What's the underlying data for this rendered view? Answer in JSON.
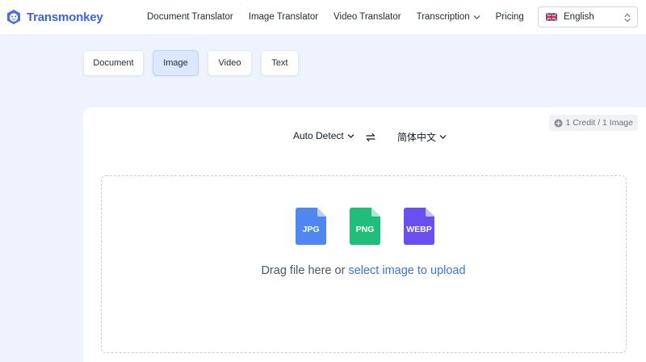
{
  "brand": {
    "name": "Transmonkey",
    "color": "#3f63d9"
  },
  "nav": {
    "items": [
      {
        "label": "Document Translator"
      },
      {
        "label": "Image Translator"
      },
      {
        "label": "Video Translator"
      },
      {
        "label": "Transcription",
        "has_dropdown": true
      },
      {
        "label": "Pricing"
      }
    ]
  },
  "language_select": {
    "value": "English",
    "flag": "uk-flag-icon"
  },
  "tabs": [
    {
      "label": "Document",
      "active": false
    },
    {
      "label": "Image",
      "active": true
    },
    {
      "label": "Video",
      "active": false
    },
    {
      "label": "Text",
      "active": false
    }
  ],
  "translator": {
    "credit_badge": "1 Credit / 1 Image",
    "source_language": "Auto Detect",
    "target_language": "简体中文",
    "file_types": [
      {
        "label": "JPG",
        "color": "#4f86f0"
      },
      {
        "label": "PNG",
        "color": "#1fbf7b"
      },
      {
        "label": "WEBP",
        "color": "#6a4ff0"
      }
    ],
    "drop_text": "Drag file here or ",
    "drop_link": "select image to upload"
  }
}
